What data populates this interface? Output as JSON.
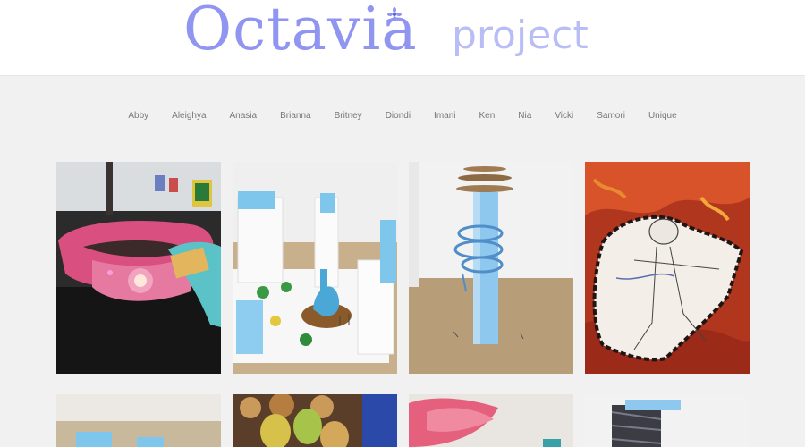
{
  "logo": {
    "title": "Octavia",
    "subtitle": "project"
  },
  "nav": [
    "Abby",
    "Aleighya",
    "Anasia",
    "Brianna",
    "Britney",
    "Diondi",
    "Imani",
    "Ken",
    "Nia",
    "Vicki",
    "Samori",
    "Unique"
  ],
  "gallery": [
    {
      "name": "wearable-pink-band-photo"
    },
    {
      "name": "foam-city-model-photo"
    },
    {
      "name": "tower-with-rings-photo"
    },
    {
      "name": "fire-figure-painting"
    },
    {
      "name": "blue-blocks-photo"
    },
    {
      "name": "painted-eggs-photo"
    },
    {
      "name": "pink-tissue-photo"
    },
    {
      "name": "wrapped-object-photo"
    }
  ],
  "colors": {
    "logo": "#8f95f0",
    "logo_sub": "#b9bdf6",
    "background": "#f1f1f1"
  }
}
